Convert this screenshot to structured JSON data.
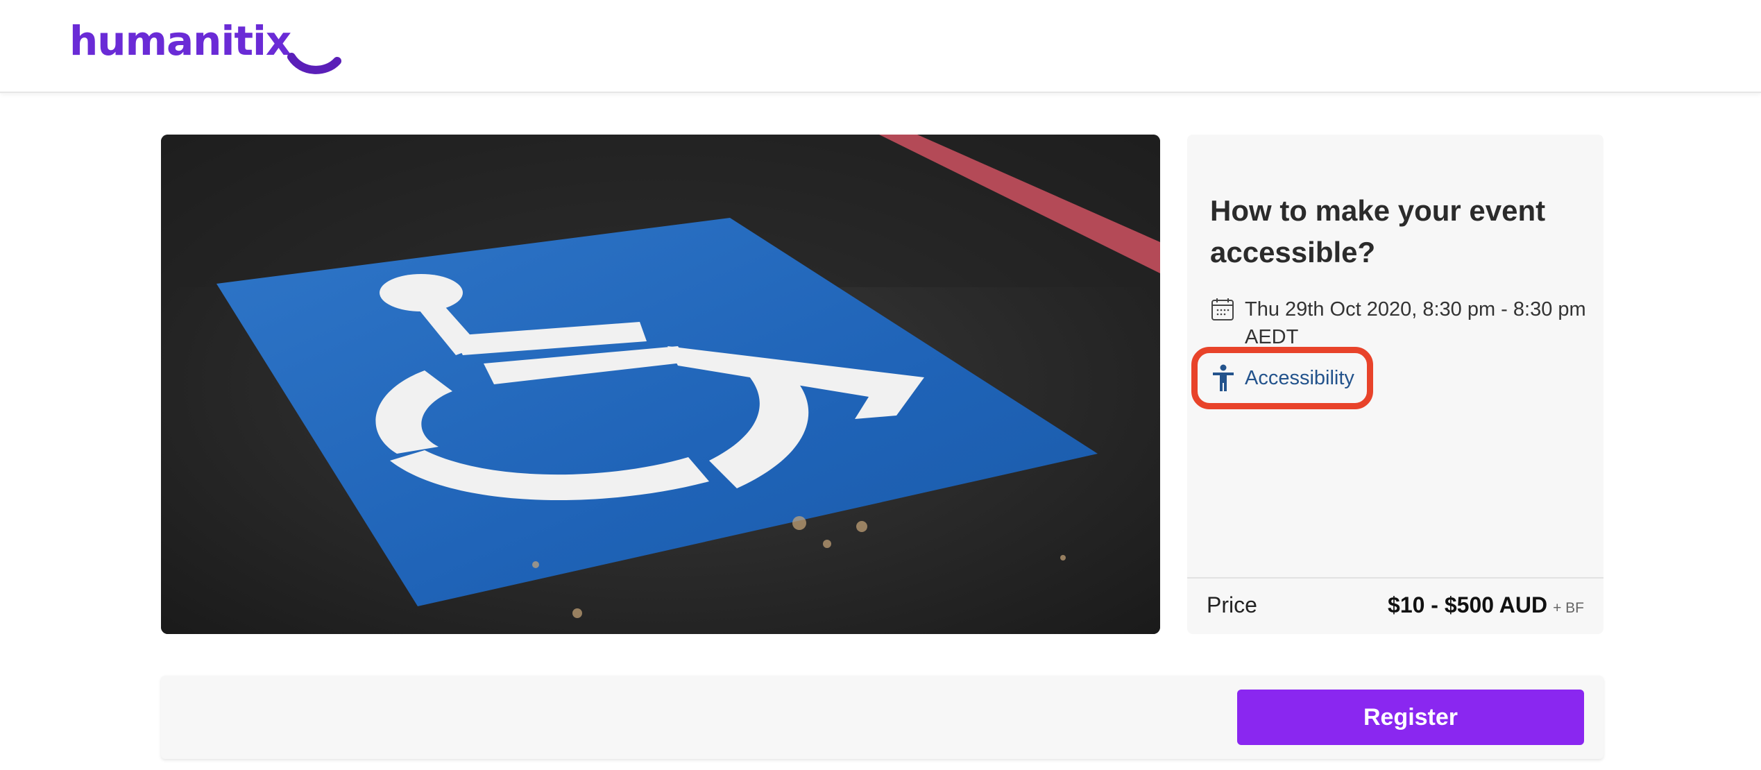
{
  "header": {
    "logo_text": "humanitix"
  },
  "hero": {
    "image_alt": "Wheelchair accessibility symbol painted on asphalt parking space"
  },
  "event": {
    "title": "How to make your event accessible?",
    "date": "Thu 29th Oct 2020, 8:30 pm - 8:30 pm AEDT",
    "accessibility_label": "Accessibility",
    "price_label": "Price",
    "price_value": "$10 - $500 AUD",
    "price_suffix": "+ BF"
  },
  "actions": {
    "register_label": "Register"
  },
  "icons": {
    "date": "calendar-icon",
    "accessibility": "accessibility-person-icon"
  },
  "colors": {
    "brand_purple": "#6a2bd6",
    "register_button": "#8a27f0",
    "accessibility_link": "#23538c",
    "highlight_ring": "#e8432a"
  }
}
